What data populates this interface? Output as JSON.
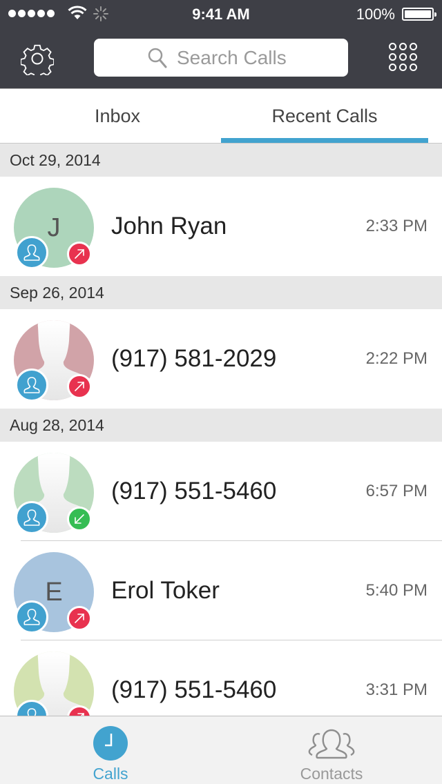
{
  "status_bar": {
    "time": "9:41 AM",
    "battery_percent": "100%",
    "signal_bars": 5,
    "battery_level": 1.0
  },
  "header": {
    "settings_icon": "gear-icon",
    "search": {
      "placeholder": "Search Calls",
      "value": ""
    },
    "keypad_icon": "keypad-grid-icon"
  },
  "tabs": {
    "items": [
      {
        "label": "Inbox",
        "active": false
      },
      {
        "label": "Recent Calls",
        "active": true
      }
    ],
    "accent_color": "#42a3cf"
  },
  "call_groups": [
    {
      "date": "Oct 29, 2014",
      "calls": [
        {
          "name": "John Ryan",
          "time": "2:33 PM",
          "avatar_initial": "J",
          "avatar_color": "#add5bb",
          "direction": "outgoing"
        }
      ]
    },
    {
      "date": "Sep 26, 2014",
      "calls": [
        {
          "name": "(917) 581-2029",
          "time": "2:22 PM",
          "avatar_initial": "",
          "avatar_color": "#d1a3a8",
          "direction": "outgoing"
        }
      ]
    },
    {
      "date": "Aug 28, 2014",
      "calls": [
        {
          "name": "(917) 551-5460",
          "time": "6:57 PM",
          "avatar_initial": "",
          "avatar_color": "#bcdcbf",
          "direction": "incoming"
        },
        {
          "name": "Erol Toker",
          "time": "5:40 PM",
          "avatar_initial": "E",
          "avatar_color": "#a8c4de",
          "direction": "outgoing"
        },
        {
          "name": "(917) 551-5460",
          "time": "3:31 PM",
          "avatar_initial": "",
          "avatar_color": "#d3e2b0",
          "direction": "outgoing"
        }
      ]
    }
  ],
  "bottom_tabs": {
    "items": [
      {
        "label": "Calls",
        "icon": "clock-icon",
        "active": true
      },
      {
        "label": "Contacts",
        "icon": "contacts-group-icon",
        "active": false
      }
    ]
  },
  "colors": {
    "header_bg": "#3e3f46",
    "accent": "#42a3cf",
    "outgoing": "#e8324f",
    "incoming": "#35bd54"
  }
}
